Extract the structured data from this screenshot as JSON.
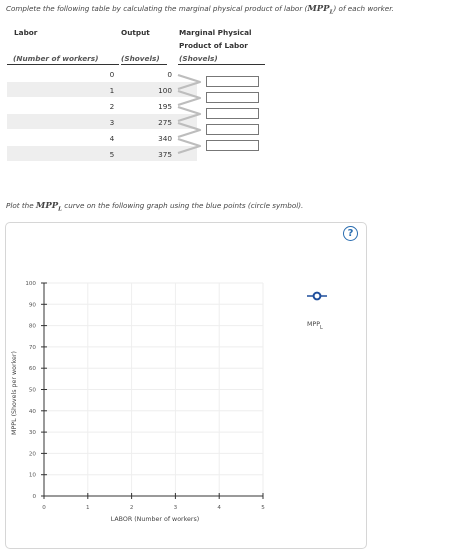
{
  "instructions": {
    "table_prefix": "Complete the following table by calculating the marginal physical product of labor (",
    "table_symbol": "MPP",
    "table_symbol_sub": "L",
    "table_suffix": ") of each worker.",
    "plot_prefix": "Plot the ",
    "plot_symbol": "MPP",
    "plot_symbol_sub": "L",
    "plot_suffix": " curve on the following graph using the blue points (circle symbol)."
  },
  "table": {
    "headers": {
      "labor": "Labor",
      "output": "Output",
      "mpp_line1": "Marginal Physical",
      "mpp_line2": "Product of Labor"
    },
    "subheaders": {
      "labor": "(Number of workers)",
      "output": "(Shovels)",
      "mpp": "(Shovels)"
    },
    "rows": [
      {
        "workers": "0",
        "output": "0"
      },
      {
        "workers": "1",
        "output": "100",
        "mpp_value": ""
      },
      {
        "workers": "2",
        "output": "195",
        "mpp_value": ""
      },
      {
        "workers": "3",
        "output": "275",
        "mpp_value": ""
      },
      {
        "workers": "4",
        "output": "340",
        "mpp_value": ""
      },
      {
        "workers": "5",
        "output": "375",
        "mpp_value": ""
      }
    ]
  },
  "graph": {
    "help_label": "?",
    "legend_label": "MPP",
    "legend_label_sub": "L",
    "colors": {
      "marker": "#1f4e9c",
      "grid": "#eeeeee",
      "axis": "#333333"
    }
  },
  "chart_data": {
    "type": "scatter",
    "xlabel": "LABOR (Number of workers)",
    "ylabel": "MPPL (Shovels per worker)",
    "xlim": [
      0,
      5
    ],
    "ylim": [
      0,
      100
    ],
    "x_ticks": [
      0,
      1,
      2,
      3,
      4,
      5
    ],
    "y_ticks": [
      0,
      10,
      20,
      30,
      40,
      50,
      60,
      70,
      80,
      90,
      100
    ],
    "grid": true,
    "series": [
      {
        "name": "MPPL",
        "marker": "circle",
        "x": [],
        "y": []
      }
    ],
    "legend_position": "right"
  }
}
